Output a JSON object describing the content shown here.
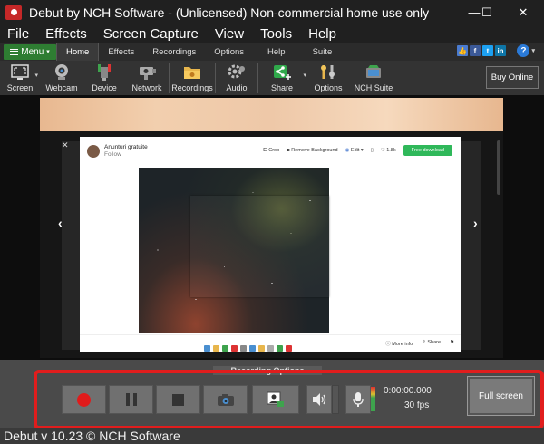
{
  "window": {
    "title": "Debut by NCH Software - (Unlicensed) Non-commercial home use only",
    "controls": {
      "minimize": "—",
      "maximize": "☐",
      "close": "✕"
    }
  },
  "menubar": [
    "File",
    "Effects",
    "Screen Capture",
    "View",
    "Tools",
    "Help"
  ],
  "ribbon": {
    "menu_label": "Menu",
    "tabs": [
      "Home",
      "Effects",
      "Recordings",
      "Options",
      "Help",
      "Suite"
    ],
    "active_tab": "Home",
    "social": [
      "like",
      "facebook",
      "twitter",
      "linkedin"
    ],
    "help_glyph": "?"
  },
  "toolbar": {
    "items": [
      {
        "label": "Screen",
        "icon": "screen-icon"
      },
      {
        "label": "Webcam",
        "icon": "webcam-icon"
      },
      {
        "label": "Device",
        "icon": "device-icon"
      },
      {
        "label": "Network",
        "icon": "network-icon"
      },
      {
        "label": "Recordings",
        "icon": "folder-icon"
      },
      {
        "label": "Audio",
        "icon": "audio-icon"
      },
      {
        "label": "Share",
        "icon": "share-icon"
      },
      {
        "label": "Options",
        "icon": "options-icon"
      },
      {
        "label": "NCH Suite",
        "icon": "suite-icon"
      }
    ],
    "buy_online": "Buy Online"
  },
  "preview": {
    "modal": {
      "username": "Anunturi gratuite",
      "follow": "Follow",
      "actions": {
        "crop": "Crop",
        "remove_bg": "Remove Background",
        "edit": "Edit",
        "likes": "1.8k",
        "free_download": "Free download"
      },
      "bottom": {
        "more_info": "More info",
        "share": "Share"
      }
    }
  },
  "recording": {
    "label": "Recording Options",
    "time": "0:00:00.000",
    "fps": "30 fps",
    "full_screen": "Full screen",
    "colors": {
      "record": "#e01b1b",
      "highlight": "#e11d1d"
    }
  },
  "status": {
    "text": "Debut v 10.23 © NCH Software"
  }
}
